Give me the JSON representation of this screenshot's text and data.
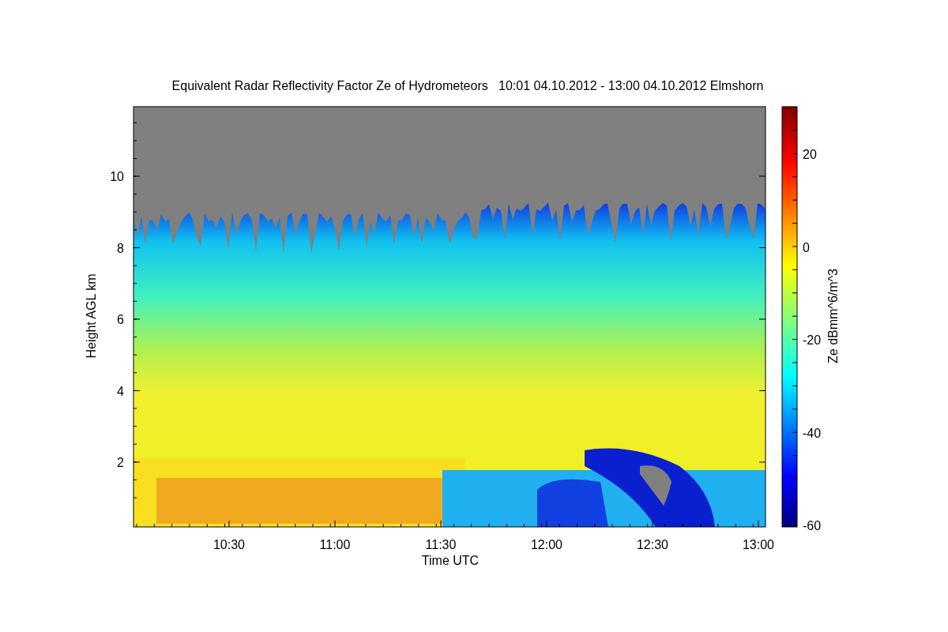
{
  "title": "Equivalent Radar Reflectivity Factor Ze of Hydrometeors   10:01 04.10.2012 - 13:00 04.10.2012 Elmshorn",
  "y_axis": {
    "label": "Height AGL km",
    "ticks": [
      "10",
      "8",
      "6",
      "4",
      "2"
    ]
  },
  "x_axis": {
    "label": "Time UTC",
    "ticks": [
      "10:30",
      "11:00",
      "11:30",
      "12:00",
      "12:30",
      "13:00"
    ]
  },
  "colorbar": {
    "label": "Ze dBmm^6/m^3",
    "ticks": [
      "20",
      "0",
      "-20",
      "-40",
      "-60"
    ]
  }
}
